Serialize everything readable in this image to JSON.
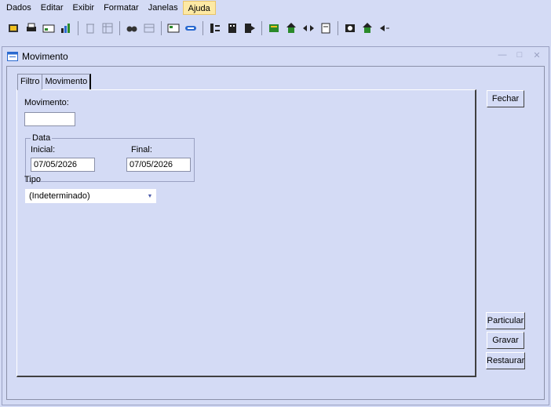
{
  "menu": {
    "items": [
      {
        "label": "Dados",
        "key": "D"
      },
      {
        "label": "Editar",
        "key": "E"
      },
      {
        "label": "Exibir",
        "key": "x"
      },
      {
        "label": "Formatar",
        "key": "F"
      },
      {
        "label": "Janelas",
        "key": "J"
      },
      {
        "label": "Ajuda",
        "key": "u"
      }
    ],
    "active": "Ajuda"
  },
  "window": {
    "title": "Movimento",
    "controls": [
      "minimize",
      "restore",
      "close"
    ]
  },
  "tabs": [
    {
      "label": "Filtro",
      "active": true
    },
    {
      "label": "Movimento",
      "active": false
    }
  ],
  "form": {
    "movimento_label": "Movimento:",
    "movimento_value": "",
    "data_group": "Data",
    "inicial_label": "Inicial:",
    "inicial_value": "07/05/2026",
    "final_label": "Final:",
    "final_value": "07/05/2026",
    "tipo_label": "Tipo",
    "tipo_value": "(Indeterminado)"
  },
  "buttons": {
    "fechar": "Fechar",
    "particular": "Particular",
    "gravar": "Gravar",
    "restaurar": "Restaurar"
  },
  "colors": {
    "background": "#d4dbf5",
    "menu_active": "#fde9a4",
    "border": "#8a90a8"
  }
}
